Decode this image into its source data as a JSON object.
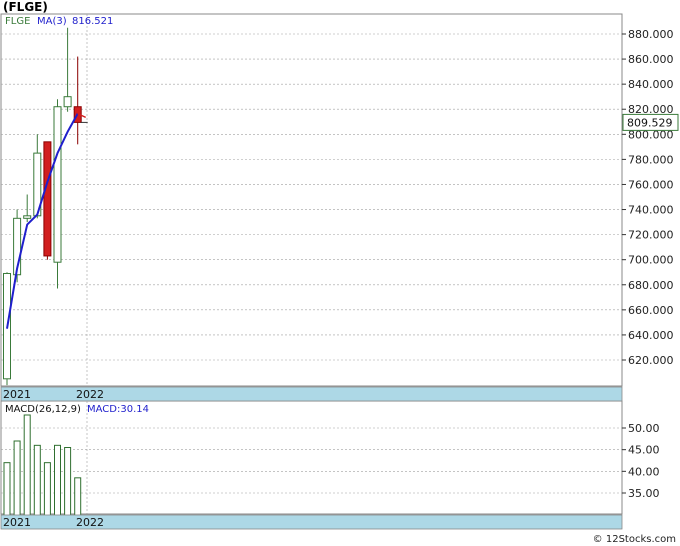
{
  "title": "(FLGE)",
  "credit": "© 12Stocks.com",
  "colors": {
    "up": "#3a7a3a",
    "down": "#d11f1f",
    "ma": "#1f1fcc",
    "price_box": "#3a7a3a",
    "axis_band": "#add8e6",
    "grid": "#a0a0a0",
    "macd_bar": "#2f6f2f"
  },
  "chart_data": [
    {
      "type": "candlestick",
      "series_label": "FLGE",
      "ma_label": "MA(3)",
      "ma_value": "816.521",
      "current_price": "809.529",
      "x_tick_labels": [
        "2021",
        "2022"
      ],
      "ylim": [
        598,
        890
      ],
      "y_ticks": [
        600,
        620,
        640,
        660,
        680,
        700,
        720,
        740,
        760,
        780,
        800,
        820,
        840,
        860,
        880
      ],
      "y_tick_labels": [
        "620.000",
        "640.000",
        "660.000",
        "680.000",
        "700.000",
        "720.000",
        "740.000",
        "760.000",
        "780.000",
        "800.000",
        "820.000",
        "840.000",
        "860.000",
        "880.000"
      ],
      "candles": [
        {
          "open": 605,
          "high": 690,
          "low": 600,
          "close": 689
        },
        {
          "open": 688,
          "high": 740,
          "low": 682,
          "close": 733
        },
        {
          "open": 733,
          "high": 752,
          "low": 730,
          "close": 735
        },
        {
          "open": 735,
          "high": 800,
          "low": 733,
          "close": 785
        },
        {
          "open": 794,
          "high": 794,
          "low": 700,
          "close": 703
        },
        {
          "open": 698,
          "high": 828,
          "low": 677,
          "close": 822
        },
        {
          "open": 822,
          "high": 885,
          "low": 818,
          "close": 830
        },
        {
          "open": 822,
          "high": 862,
          "low": 792,
          "close": 809.5
        }
      ],
      "ma": [
        645,
        693,
        728,
        736,
        762,
        785,
        802,
        816.5
      ]
    },
    {
      "type": "bar",
      "indicator_label": "MACD(26,12,9)",
      "value_label": "MACD:30.14",
      "x_tick_labels": [
        "2021",
        "2022"
      ],
      "ylim": [
        27,
        56
      ],
      "y_ticks": [
        35,
        40,
        45,
        50
      ],
      "y_tick_labels": [
        "35.00",
        "40.00",
        "45.00",
        "50.00"
      ],
      "values": [
        42,
        47,
        53,
        46,
        42,
        46,
        45.5,
        38.5
      ]
    }
  ]
}
